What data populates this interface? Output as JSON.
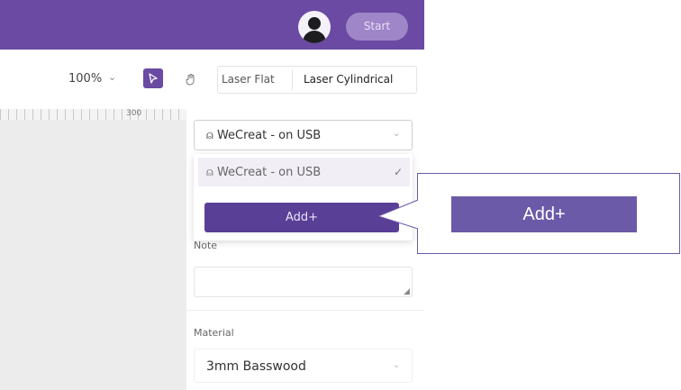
{
  "header": {
    "start_label": "Start",
    "accent_color": "#6a4aa3"
  },
  "toolbar": {
    "zoom_level": "100%",
    "zoom_chevron": "⌄",
    "select_tool_icon": "cursor-arrow-icon",
    "hand_tool_icon": "hand-icon",
    "tabs": [
      {
        "label": "Laser Flat"
      },
      {
        "label": "Laser Cylindrical"
      }
    ]
  },
  "panel": {
    "device_select": {
      "value": "WeCreat - on USB",
      "icon": "device-icon",
      "chevron": "⌄"
    },
    "dropdown": {
      "options": [
        {
          "label": "WeCreat - on USB",
          "selected": true,
          "check": "✓"
        }
      ],
      "add_label": "Add+"
    },
    "note": {
      "label": "Note",
      "value": ""
    },
    "material": {
      "label": "Material",
      "value": "3mm Basswood",
      "chevron": "⌄"
    }
  },
  "callout": {
    "label": "Add+",
    "color": "#6a5aa8"
  }
}
